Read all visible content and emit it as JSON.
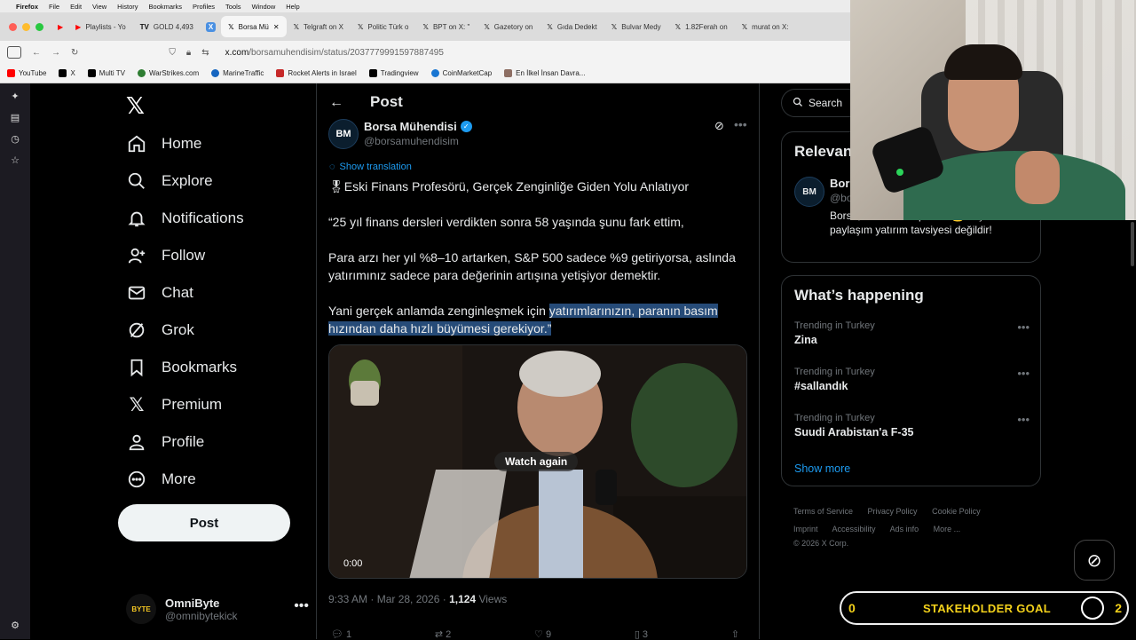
{
  "menubar": {
    "app": "Firefox",
    "items": [
      "File",
      "Edit",
      "View",
      "History",
      "Bookmarks",
      "Profiles",
      "Tools",
      "Window",
      "Help"
    ]
  },
  "tabs": [
    {
      "label": "Playlists - Yo",
      "icon": "youtube-icon"
    },
    {
      "label": "GOLD 4,493",
      "icon": "tradingview-icon"
    },
    {
      "label": "Borsa Mü",
      "icon": "x-icon",
      "active": true
    },
    {
      "label": "Telgraft on X",
      "icon": "x-icon"
    },
    {
      "label": "Politic Türk o",
      "icon": "x-icon"
    },
    {
      "label": "BPT on X: \"",
      "icon": "x-icon"
    },
    {
      "label": "Gazetory on",
      "icon": "x-icon"
    },
    {
      "label": "Gıda Dedekt",
      "icon": "x-icon"
    },
    {
      "label": "Bulvar Medy",
      "icon": "x-icon"
    },
    {
      "label": "1.82Ferah on",
      "icon": "x-icon"
    },
    {
      "label": "murat on X:",
      "icon": "x-icon"
    }
  ],
  "url": {
    "host": "x.com",
    "path": "/borsamuhendisim/status/2037779991597887495"
  },
  "bookmarks": [
    {
      "label": "YouTube",
      "color": "#ff0000"
    },
    {
      "label": "X",
      "color": "#000000"
    },
    {
      "label": "Multi TV",
      "color": "#000000"
    },
    {
      "label": "WarStrikes.com",
      "color": "#2e7d32"
    },
    {
      "label": "MarineTraffic",
      "color": "#1565c0"
    },
    {
      "label": "Rocket Alerts in Israel",
      "color": "#c62828"
    },
    {
      "label": "Tradingview",
      "color": "#000000"
    },
    {
      "label": "CoinMarketCap",
      "color": "#1976d2"
    },
    {
      "label": "En İlkel İnsan Davra...",
      "color": "#8d6e63"
    }
  ],
  "nav": {
    "items": [
      {
        "label": "Home",
        "icon": "home-icon"
      },
      {
        "label": "Explore",
        "icon": "search-icon"
      },
      {
        "label": "Notifications",
        "icon": "bell-icon"
      },
      {
        "label": "Follow",
        "icon": "follow-icon"
      },
      {
        "label": "Chat",
        "icon": "mail-icon"
      },
      {
        "label": "Grok",
        "icon": "grok-icon"
      },
      {
        "label": "Bookmarks",
        "icon": "bookmark-icon"
      },
      {
        "label": "Premium",
        "icon": "x-icon"
      },
      {
        "label": "Profile",
        "icon": "profile-icon"
      },
      {
        "label": "More",
        "icon": "more-icon"
      }
    ],
    "post_button": "Post",
    "account": {
      "name": "OmniByte",
      "handle": "@omnibytekick",
      "avatar_text": "BYTE"
    }
  },
  "post": {
    "header": "Post",
    "author_name": "Borsa Mühendisi",
    "author_handle": "@borsamuhendisim",
    "avatar_text": "BM",
    "show_translation": "Show translation",
    "line1": "🎖Eski Finans Profesörü, Gerçek Zenginliğe Giden Yolu Anlatıyor",
    "line2": "“25 yıl finans dersleri verdikten sonra 58 yaşında şunu fark ettim,",
    "line3": "Para arzı her yıl %8–10 artarken, S&P 500 sadece %9 getiriyorsa, aslında yatırımınız sadece para değerinin artışına yetişiyor demektir.",
    "line4_plain": "Yani gerçek anlamda zenginleşmek için ",
    "line4_highlight": "yatırımlarınızın, paranın basım hızından daha hızlı büyümesi gerekiyor.”",
    "video": {
      "overlay": "Watch again",
      "time": "0:00"
    },
    "time": "9:33 AM · Mar 28, 2026 · ",
    "views_count": "1,124",
    "views_label": " Views",
    "actions": {
      "replies": "1",
      "reposts": "2",
      "likes": "9",
      "bookmarks": "3"
    }
  },
  "right": {
    "search_placeholder": "Search",
    "relevant": {
      "title": "Relevan",
      "name": "Bor",
      "handle": "@bo",
      "bio": "Borsa, ... servet kapısıdır 💰 Hiçbir paylaşım yatırım tavsiyesi değildir!"
    },
    "happening": {
      "title": "What’s happening",
      "trends": [
        {
          "context": "Trending in Turkey",
          "title": "Zina"
        },
        {
          "context": "Trending in Turkey",
          "title": "#sallandık"
        },
        {
          "context": "Trending in Turkey",
          "title": "Suudi Arabistan'a F-35"
        }
      ],
      "show_more": "Show more"
    },
    "footer": [
      "Terms of Service",
      "Privacy Policy",
      "Cookie Policy",
      "Imprint",
      "Accessibility",
      "Ads info",
      "More ...",
      "© 2026 X Corp."
    ]
  },
  "overlay": {
    "goal_left": "0",
    "goal_title": "STAKEHOLDER GOAL",
    "goal_right": "2"
  }
}
